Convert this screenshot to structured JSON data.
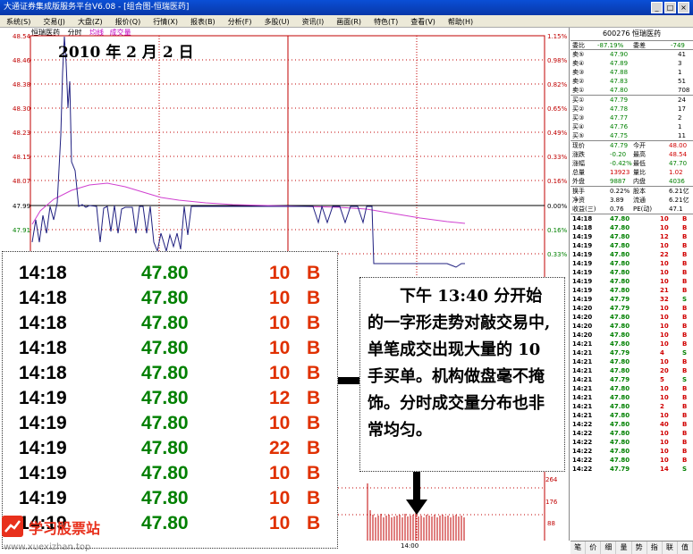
{
  "window": {
    "title": "大通证券集成版服务平台V6.08 - [组合图-恒瑞医药]",
    "buttons": [
      "_",
      "□",
      "×"
    ]
  },
  "menu": [
    "系统(S)",
    "交易(J)",
    "大盘(Z)",
    "报价(Q)",
    "行情(X)",
    "报表(B)",
    "分析(F)",
    "多股(U)",
    "资讯(I)",
    "画面(R)",
    "特色(T)",
    "查看(V)",
    "帮助(H)"
  ],
  "chart_header": {
    "name": "恒瑞医药",
    "mode": "分时",
    "avg": "均线",
    "vol": "成交量"
  },
  "left_axis": [
    "48.54",
    "48.46",
    "48.38",
    "48.30",
    "48.23",
    "48.15",
    "48.07",
    "47.99",
    "47.91"
  ],
  "right_axis": [
    "1.15%",
    "0.98%",
    "0.82%",
    "0.65%",
    "0.49%",
    "0.33%",
    "0.16%",
    "0.00%",
    "0.16%",
    "0.33%"
  ],
  "vol_axis": [
    "264",
    "176",
    "88"
  ],
  "time_label": "14:00",
  "date_caption": "2010 年 2 月 2 日",
  "zoom_rows": [
    {
      "t": "14:18",
      "p": "47.80",
      "v": "10",
      "b": "B"
    },
    {
      "t": "14:18",
      "p": "47.80",
      "v": "10",
      "b": "B"
    },
    {
      "t": "14:18",
      "p": "47.80",
      "v": "10",
      "b": "B"
    },
    {
      "t": "14:18",
      "p": "47.80",
      "v": "10",
      "b": "B"
    },
    {
      "t": "14:18",
      "p": "47.80",
      "v": "10",
      "b": "B"
    },
    {
      "t": "14:19",
      "p": "47.80",
      "v": "12",
      "b": "B"
    },
    {
      "t": "14:19",
      "p": "47.80",
      "v": "10",
      "b": "B"
    },
    {
      "t": "14:19",
      "p": "47.80",
      "v": "22",
      "b": "B"
    },
    {
      "t": "14:19",
      "p": "47.80",
      "v": "10",
      "b": "B"
    },
    {
      "t": "14:19",
      "p": "47.80",
      "v": "10",
      "b": "B"
    },
    {
      "t": "14:19",
      "p": "47.80",
      "v": "10",
      "b": "B"
    }
  ],
  "note": "下午 13:40 分开始的一字形走势对敲交易中,单笔成交出现大量的 10 手买单。机构做盘毫不掩饰。分时成交量分布也非常均匀。",
  "quote": {
    "code_name": "600276 恒瑞医药",
    "wb_label": "委比",
    "wb": "-87.19%",
    "wc_label": "委差",
    "wc": "-749",
    "asks": [
      {
        "l": "卖⑤",
        "p": "47.90",
        "v": "41"
      },
      {
        "l": "卖④",
        "p": "47.89",
        "v": "3"
      },
      {
        "l": "卖③",
        "p": "47.88",
        "v": "1"
      },
      {
        "l": "卖②",
        "p": "47.83",
        "v": "51"
      },
      {
        "l": "卖①",
        "p": "47.80",
        "v": "708"
      }
    ],
    "bids": [
      {
        "l": "买①",
        "p": "47.79",
        "v": "24"
      },
      {
        "l": "买②",
        "p": "47.78",
        "v": "17"
      },
      {
        "l": "买③",
        "p": "47.77",
        "v": "2"
      },
      {
        "l": "买④",
        "p": "47.76",
        "v": "1"
      },
      {
        "l": "买⑤",
        "p": "47.75",
        "v": "11"
      }
    ],
    "stats": [
      [
        "现价",
        "47.79",
        "今开",
        "48.00"
      ],
      [
        "涨跌",
        "-0.20",
        "最高",
        "48.54"
      ],
      [
        "涨幅",
        "-0.42%",
        "最低",
        "47.70"
      ],
      [
        "总量",
        "13923",
        "量比",
        "1.02"
      ],
      [
        "外盘",
        "9887",
        "内盘",
        "4036"
      ]
    ],
    "stats2": [
      [
        "换手",
        "0.22%",
        "股本",
        "6.21亿"
      ],
      [
        "净资",
        "3.89",
        "流通",
        "6.21亿"
      ],
      [
        "收益(三)",
        "0.76",
        "PE(动)",
        "47.1"
      ]
    ]
  },
  "ticks": [
    [
      "14:18",
      "47.80",
      "10",
      "B"
    ],
    [
      "14:18",
      "47.80",
      "10",
      "B"
    ],
    [
      "14:19",
      "47.80",
      "12",
      "B"
    ],
    [
      "14:19",
      "47.80",
      "10",
      "B"
    ],
    [
      "14:19",
      "47.80",
      "22",
      "B"
    ],
    [
      "14:19",
      "47.80",
      "10",
      "B"
    ],
    [
      "14:19",
      "47.80",
      "10",
      "B"
    ],
    [
      "14:19",
      "47.80",
      "10",
      "B"
    ],
    [
      "14:19",
      "47.80",
      "21",
      "B"
    ],
    [
      "14:19",
      "47.79",
      "32",
      "S"
    ],
    [
      "14:20",
      "47.79",
      "10",
      "B"
    ],
    [
      "14:20",
      "47.80",
      "10",
      "B"
    ],
    [
      "14:20",
      "47.80",
      "10",
      "B"
    ],
    [
      "14:20",
      "47.80",
      "10",
      "B"
    ],
    [
      "14:21",
      "47.80",
      "10",
      "B"
    ],
    [
      "14:21",
      "47.79",
      "4",
      "S"
    ],
    [
      "14:21",
      "47.80",
      "10",
      "B"
    ],
    [
      "14:21",
      "47.80",
      "20",
      "B"
    ],
    [
      "14:21",
      "47.79",
      "5",
      "S"
    ],
    [
      "14:21",
      "47.80",
      "10",
      "B"
    ],
    [
      "14:21",
      "47.80",
      "10",
      "B"
    ],
    [
      "14:21",
      "47.80",
      "2",
      "B"
    ],
    [
      "14:21",
      "47.80",
      "10",
      "B"
    ],
    [
      "14:22",
      "47.80",
      "40",
      "B"
    ],
    [
      "14:22",
      "47.80",
      "10",
      "B"
    ],
    [
      "14:22",
      "47.80",
      "10",
      "B"
    ],
    [
      "14:22",
      "47.80",
      "10",
      "B"
    ],
    [
      "14:22",
      "47.80",
      "10",
      "B"
    ],
    [
      "14:22",
      "47.79",
      "14",
      "S"
    ]
  ],
  "tabs": [
    "笔",
    "价",
    "细",
    "量",
    "势",
    "指",
    "联",
    "值"
  ],
  "logo": {
    "text": "学习股票站",
    "url": "www.xuexizhan.top"
  }
}
